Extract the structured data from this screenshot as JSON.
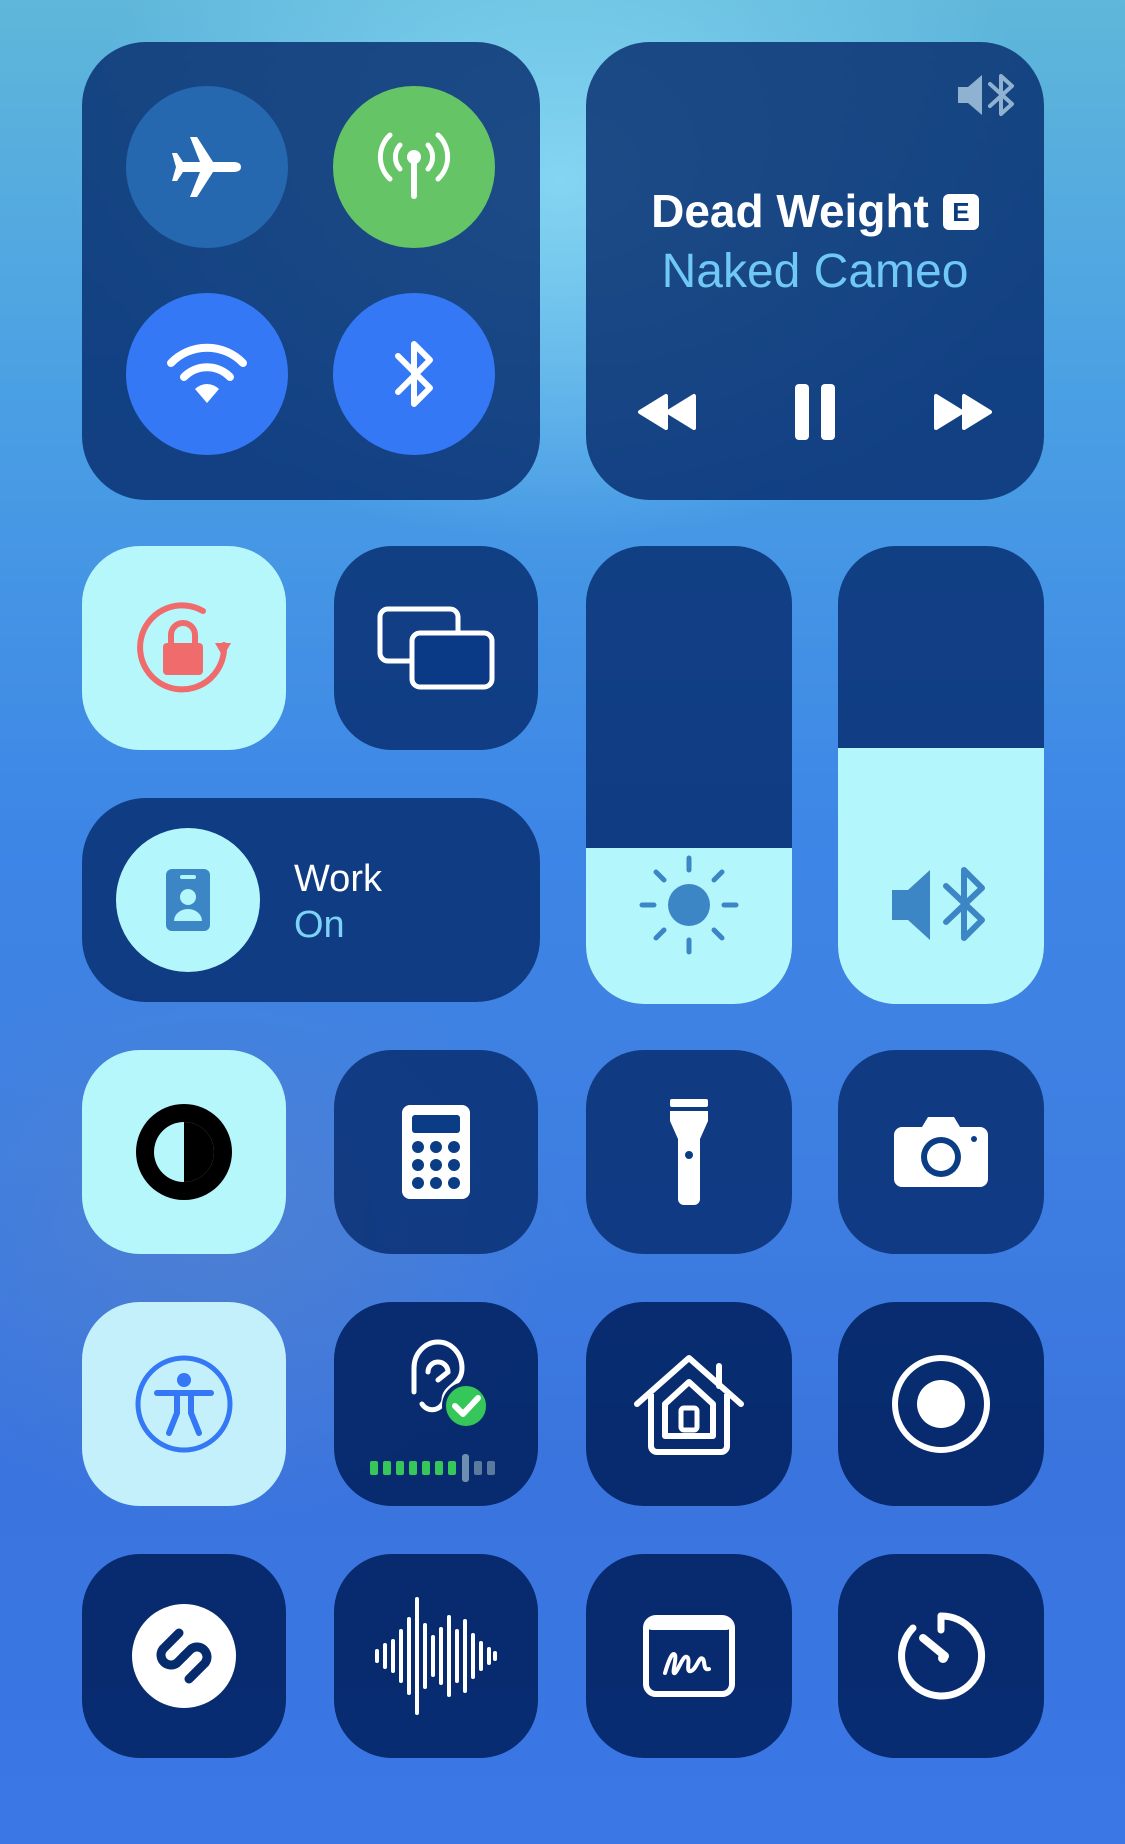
{
  "connectivity": {
    "airplane_mode": {
      "icon": "airplane-icon",
      "active": false
    },
    "cellular_data": {
      "icon": "antenna-icon",
      "active": true,
      "color": "#64c466"
    },
    "wifi": {
      "icon": "wifi-icon",
      "active": true,
      "color": "#3478f6"
    },
    "bluetooth": {
      "icon": "bluetooth-icon",
      "active": true,
      "color": "#3478f6"
    }
  },
  "now_playing": {
    "title": "Dead Weight",
    "explicit_badge": "E",
    "artist": "Naked Cameo",
    "output_icon": "speaker-bluetooth-icon",
    "controls": [
      "rewind",
      "pause",
      "fast-forward"
    ]
  },
  "orientation_lock": {
    "icon": "rotation-lock-icon",
    "active": true,
    "color": "#f06b6b"
  },
  "screen_mirroring": {
    "icon": "screen-mirroring-icon",
    "active": false
  },
  "focus": {
    "title": "Work",
    "state": "On",
    "icon": "work-badge-icon"
  },
  "brightness": {
    "icon": "sun-icon",
    "level": 0.34
  },
  "volume": {
    "icon": "speaker-bluetooth-icon",
    "level": 0.56
  },
  "controls": [
    {
      "name": "dark-mode",
      "icon": "dark-mode-icon",
      "active": true
    },
    {
      "name": "calculator",
      "icon": "calculator-icon",
      "active": false
    },
    {
      "name": "flashlight",
      "icon": "flashlight-icon",
      "active": false
    },
    {
      "name": "camera",
      "icon": "camera-icon",
      "active": false
    },
    {
      "name": "accessibility",
      "icon": "accessibility-icon",
      "active": true
    },
    {
      "name": "hearing",
      "icon": "hearing-icon",
      "active": false,
      "accent": "#35c759"
    },
    {
      "name": "home",
      "icon": "home-icon",
      "active": false
    },
    {
      "name": "screen-recording",
      "icon": "record-icon",
      "active": false
    },
    {
      "name": "shazam",
      "icon": "shazam-icon",
      "active": false
    },
    {
      "name": "voice-memos",
      "icon": "waveform-icon",
      "active": false
    },
    {
      "name": "notes",
      "icon": "signature-icon",
      "active": false
    },
    {
      "name": "timer",
      "icon": "timer-icon",
      "active": false
    }
  ]
}
